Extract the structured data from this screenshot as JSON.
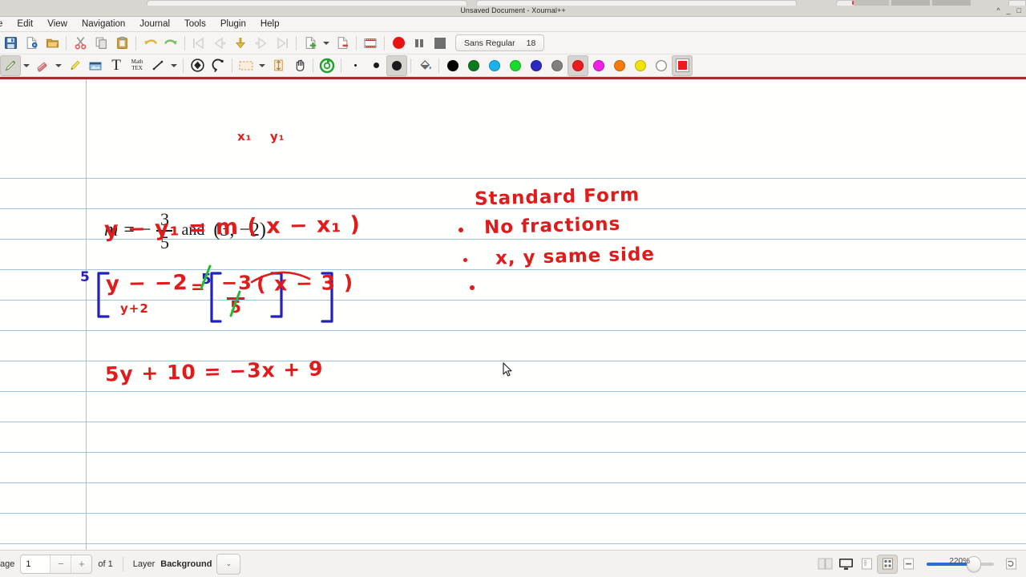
{
  "window": {
    "title": "Unsaved Document - Xournal++",
    "controls": [
      "^",
      "_",
      "□"
    ]
  },
  "menubar": {
    "items": [
      "e",
      "Edit",
      "View",
      "Navigation",
      "Journal",
      "Tools",
      "Plugin",
      "Help"
    ]
  },
  "toolbar_row1": {
    "buttons": [
      {
        "name": "save-icon",
        "label": "Save"
      },
      {
        "name": "new-document-icon",
        "label": "New"
      },
      {
        "name": "open-folder-icon",
        "label": "Open"
      },
      {
        "name": "cut-icon",
        "label": "Cut"
      },
      {
        "name": "copy-icon",
        "label": "Copy"
      },
      {
        "name": "paste-icon",
        "label": "Paste"
      },
      {
        "name": "undo-icon",
        "label": "Undo"
      },
      {
        "name": "redo-icon",
        "label": "Redo"
      },
      {
        "name": "first-page-icon",
        "label": "First page"
      },
      {
        "name": "previous-page-icon",
        "label": "Previous page"
      },
      {
        "name": "goto-page-icon",
        "label": "Go to page"
      },
      {
        "name": "next-page-icon",
        "label": "Next page"
      },
      {
        "name": "last-page-icon",
        "label": "Last page"
      },
      {
        "name": "insert-page-icon",
        "label": "Insert page"
      },
      {
        "name": "insert-page-dropdown-icon",
        "label": "Insert page options"
      },
      {
        "name": "delete-page-icon",
        "label": "Delete page"
      },
      {
        "name": "fullscreen-icon",
        "label": "Fullscreen"
      },
      {
        "name": "record-icon",
        "label": "Record audio"
      },
      {
        "name": "pause-icon",
        "label": "Pause audio"
      },
      {
        "name": "stop-icon",
        "label": "Stop audio"
      }
    ]
  },
  "font_button": {
    "family": "Sans Regular",
    "size": "18"
  },
  "toolbar_row2": {
    "buttons": [
      {
        "name": "pen-tool-icon",
        "label": "Pen"
      },
      {
        "name": "pen-dropdown-icon",
        "label": "Pen options"
      },
      {
        "name": "eraser-tool-icon",
        "label": "Eraser"
      },
      {
        "name": "eraser-dropdown-icon",
        "label": "Eraser options"
      },
      {
        "name": "highlighter-tool-icon",
        "label": "Highlighter"
      },
      {
        "name": "image-tool-icon",
        "label": "Insert image"
      },
      {
        "name": "text-tool-icon",
        "label": "Text"
      },
      {
        "name": "math-tex-tool-icon",
        "label": "Math TeX"
      },
      {
        "name": "line-tool-icon",
        "label": "Line"
      },
      {
        "name": "line-dropdown-icon",
        "label": "Line options"
      },
      {
        "name": "shape-recognizer-icon",
        "label": "Shape recognizer"
      },
      {
        "name": "lasso-select-icon",
        "label": "Select region"
      },
      {
        "name": "select-rectangle-icon",
        "label": "Select rectangle"
      },
      {
        "name": "select-rectangle-dropdown-icon",
        "label": "Select options"
      },
      {
        "name": "vertical-space-icon",
        "label": "Vertical space"
      },
      {
        "name": "hand-tool-icon",
        "label": "Hand"
      },
      {
        "name": "default-tool-icon",
        "label": "Default tool"
      }
    ],
    "thickness": [
      {
        "name": "thickness-very-fine",
        "label": "Very fine"
      },
      {
        "name": "thickness-fine",
        "label": "Fine"
      },
      {
        "name": "thickness-medium",
        "label": "Medium",
        "selected": true
      }
    ],
    "fill_icon": {
      "name": "fill-tool-icon",
      "label": "Fill"
    },
    "colors": [
      {
        "name": "color-black",
        "hex": "#000000"
      },
      {
        "name": "color-dark-green",
        "hex": "#0d7a1f"
      },
      {
        "name": "color-cyan",
        "hex": "#19b3ea"
      },
      {
        "name": "color-green",
        "hex": "#1bdb2c"
      },
      {
        "name": "color-blue",
        "hex": "#2b2bc4"
      },
      {
        "name": "color-gray",
        "hex": "#808080"
      },
      {
        "name": "color-red",
        "hex": "#ed1c1c",
        "selected": true
      },
      {
        "name": "color-magenta",
        "hex": "#ef1fe4"
      },
      {
        "name": "color-orange",
        "hex": "#f57c0a"
      },
      {
        "name": "color-yellow",
        "hex": "#f3e208"
      },
      {
        "name": "color-white",
        "hex": "#ffffff"
      }
    ],
    "color_picker": {
      "name": "color-picker-swatch",
      "hex": "#ed1c1c"
    }
  },
  "document": {
    "equation_latex": {
      "m": "m",
      "equals": "=",
      "minus": "−",
      "numerator": "3",
      "denominator": "5",
      "and": "and",
      "point": "(3, −2)"
    },
    "annotations": {
      "x_sub1": "x₁",
      "y_sub1": "y₁",
      "point_slope": "y − y₁  =  m ( x − x₁ )",
      "bracket_left_multiplier": "5",
      "bracket_left_inner": "y − −2",
      "bracket_left_under": "y+2",
      "bracket_equals": "=",
      "bracket_right_multiplier": "5",
      "right_numerator": "−3",
      "right_denominator": "5",
      "right_paren": "( x − 3 )",
      "final_line": "5y + 10  =  −3x + 9"
    },
    "notes": {
      "heading": "Standard Form",
      "bullets": [
        "No fractions",
        "x, y same side",
        ""
      ]
    }
  },
  "statusbar": {
    "page_label": "age",
    "page_value": "1",
    "minus": "−",
    "plus": "+",
    "of_label": "of 1",
    "layer_label": "Layer",
    "layer_value": "Background",
    "layer_dropdown": "⌄",
    "zoom_label": "220%",
    "view_buttons": [
      {
        "name": "dual-page-view-icon",
        "label": "Dual page"
      },
      {
        "name": "presentation-mode-icon",
        "label": "Presentation mode"
      },
      {
        "name": "zoom-fit-width-icon",
        "label": "Fit width"
      },
      {
        "name": "zoom-fit-page-icon",
        "label": "Fit page",
        "selected": true
      },
      {
        "name": "zoom-out-icon",
        "label": "Zoom out"
      },
      {
        "name": "zoom-reset-icon",
        "label": "Zoom 100%"
      }
    ]
  }
}
